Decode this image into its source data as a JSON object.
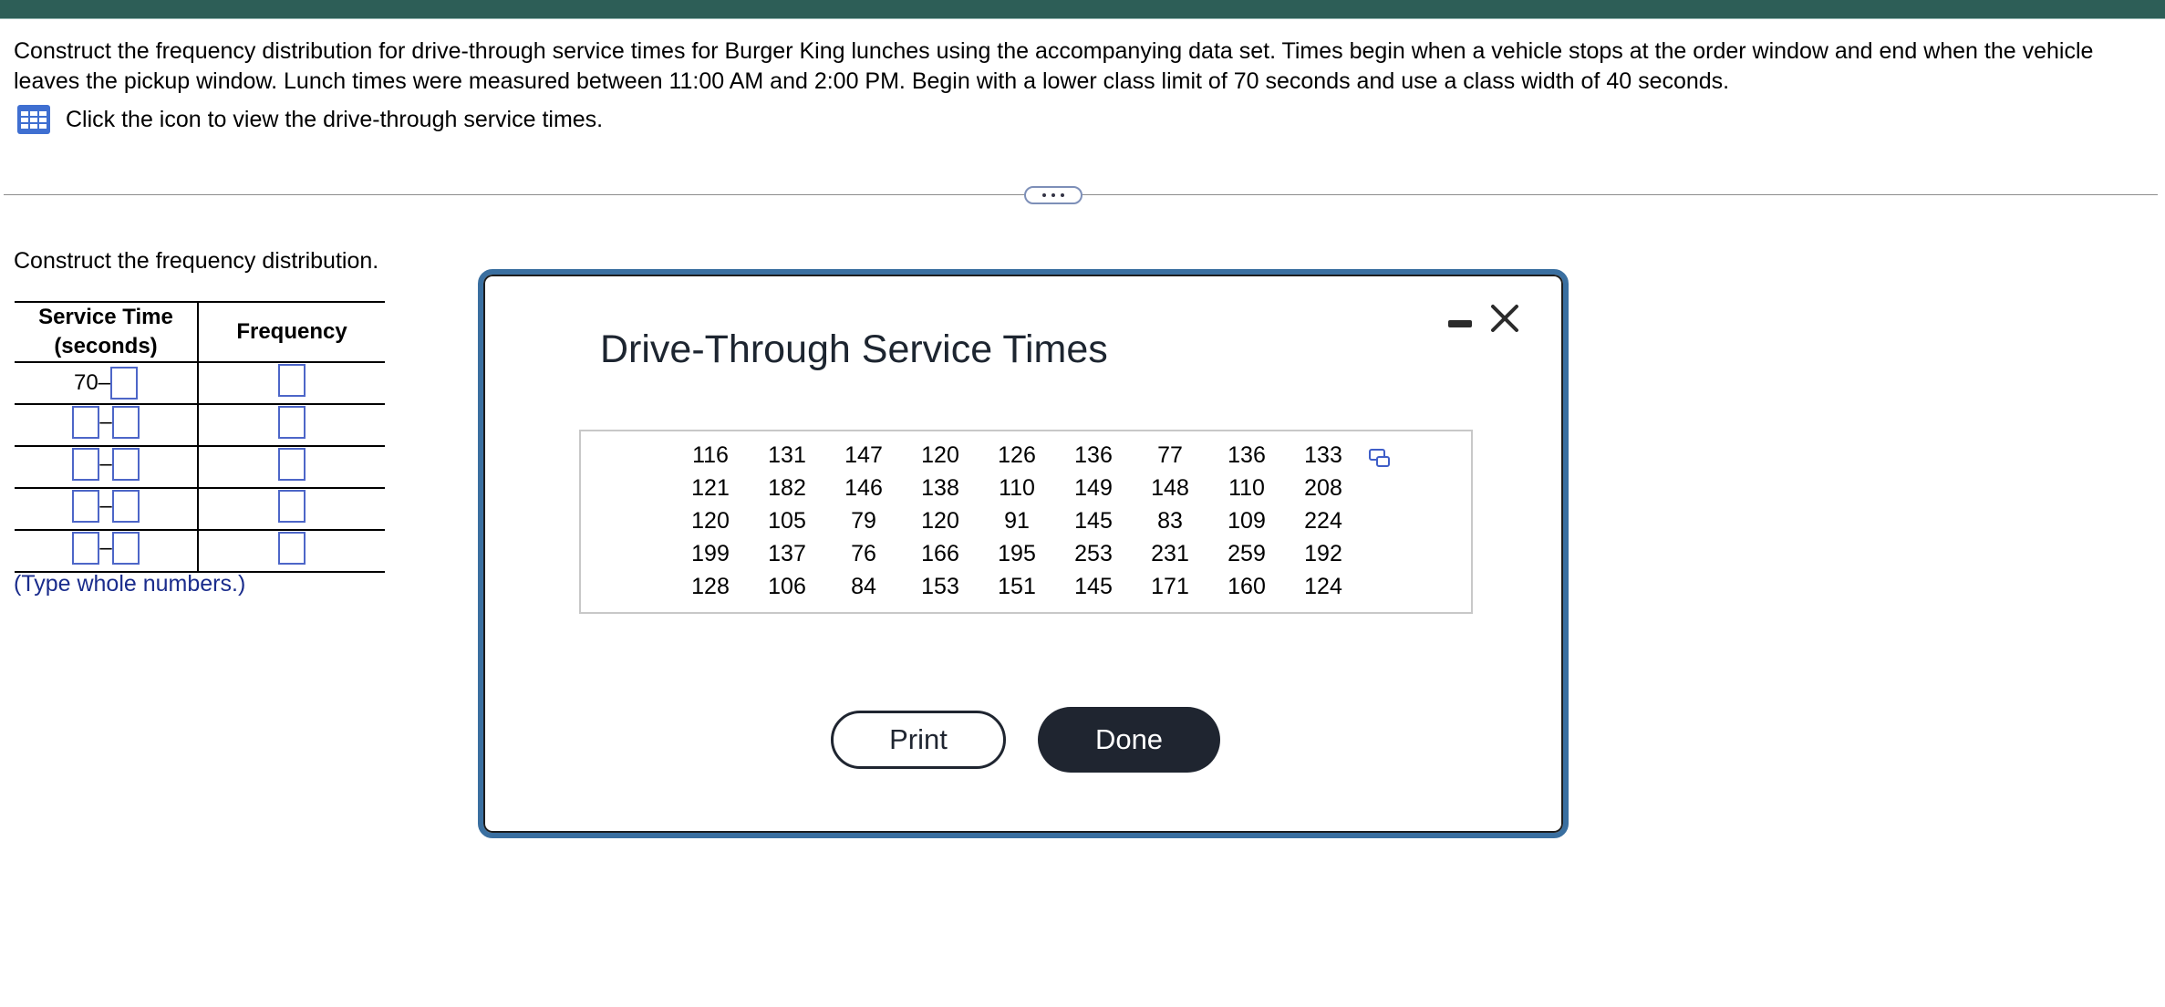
{
  "question": {
    "text": "Construct the frequency distribution for drive-through service times for Burger King lunches using the accompanying data set. Times begin when a vehicle stops at the order window and end when the vehicle leaves the pickup window. Lunch times were measured between 11:00 AM and 2:00 PM. Begin with a lower class limit of 70 seconds and use a class width of 40 seconds.",
    "icon_link_text": "Click the icon to view the drive-through service times.",
    "icon": "data-table-icon"
  },
  "more_button_icon": "ellipsis-icon",
  "work_area": {
    "prompt": "Construct the frequency distribution.",
    "table": {
      "headers": [
        "Service Time (seconds)",
        "Frequency"
      ],
      "first_lower_limit": "70",
      "dash": "–",
      "rows": 5
    },
    "note": "(Type whole numbers.)"
  },
  "modal": {
    "title": "Drive-Through Service Times",
    "minimize_icon": "minimize-icon",
    "close_icon": "close-icon",
    "copy_icon": "copy-icon",
    "data": [
      [
        "116",
        "131",
        "147",
        "120",
        "126",
        "136",
        "77",
        "136",
        "133"
      ],
      [
        "121",
        "182",
        "146",
        "138",
        "110",
        "149",
        "148",
        "110",
        "208"
      ],
      [
        "120",
        "105",
        "79",
        "120",
        "91",
        "145",
        "83",
        "109",
        "224"
      ],
      [
        "199",
        "137",
        "76",
        "166",
        "195",
        "253",
        "231",
        "259",
        "192"
      ],
      [
        "128",
        "106",
        "84",
        "153",
        "151",
        "145",
        "171",
        "160",
        "124"
      ]
    ],
    "print_label": "Print",
    "done_label": "Done"
  },
  "colors": {
    "top_bar": "#2d5e57",
    "input_border": "#4d66c8",
    "modal_border": "#3a6fa0",
    "done_button": "#1f2530",
    "note_text": "#1a2c8c"
  }
}
